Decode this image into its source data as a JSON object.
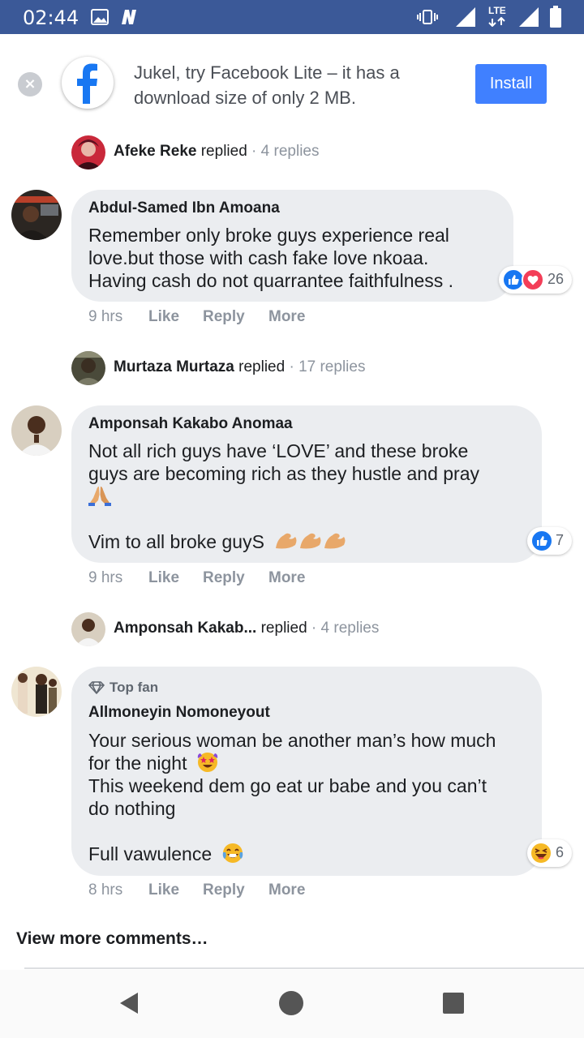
{
  "status_bar": {
    "time": "02:44",
    "network": "LTE"
  },
  "banner": {
    "text": "Jukel, try Facebook Lite – it has a download size of only 2 MB.",
    "install_label": "Install"
  },
  "replies": [
    {
      "name": "Afeke Reke",
      "verb": " replied",
      "count": " · 4 replies"
    },
    {
      "name": "Murtaza Murtaza",
      "verb": " replied",
      "count": " · 17 replies"
    },
    {
      "name": "Amponsah Kakab...",
      "verb": " replied",
      "count": " · 4 replies"
    }
  ],
  "comments": [
    {
      "author": "Abdul-Samed Ibn Amoana",
      "lines": [
        "Remember only broke guys experience real",
        "love.but those with cash fake love nkoaa.",
        "Having cash do not quarrantee faithfulness ."
      ],
      "reaction_count": "26",
      "time": "9 hrs",
      "like": "Like",
      "reply": "Reply",
      "more": "More"
    },
    {
      "author": "Amponsah Kakabo Anomaa",
      "lines": [
        "Not all rich guys have ‘LOVE’ and these broke",
        "guys are becoming rich as they hustle and pray",
        "Vim to all broke guyS"
      ],
      "reaction_count": "7",
      "time": "9 hrs",
      "like": "Like",
      "reply": "Reply",
      "more": "More"
    },
    {
      "badge": "Top fan",
      "author": "Allmoneyin Nomoneyout",
      "lines": [
        "Your serious woman be another man’s how much",
        "for the night",
        "This weekend dem go eat ur babe and you can’t",
        "do nothing",
        "Full vawulence"
      ],
      "reaction_count": "6",
      "time": "8 hrs",
      "like": "Like",
      "reply": "Reply",
      "more": "More"
    }
  ],
  "footer": {
    "view_more": "View more comments…"
  },
  "colors": {
    "facebook_blue": "#3b5998",
    "install_blue": "#4080ff",
    "bubble_gray": "#ebedf0",
    "meta_gray": "#8d949e"
  }
}
